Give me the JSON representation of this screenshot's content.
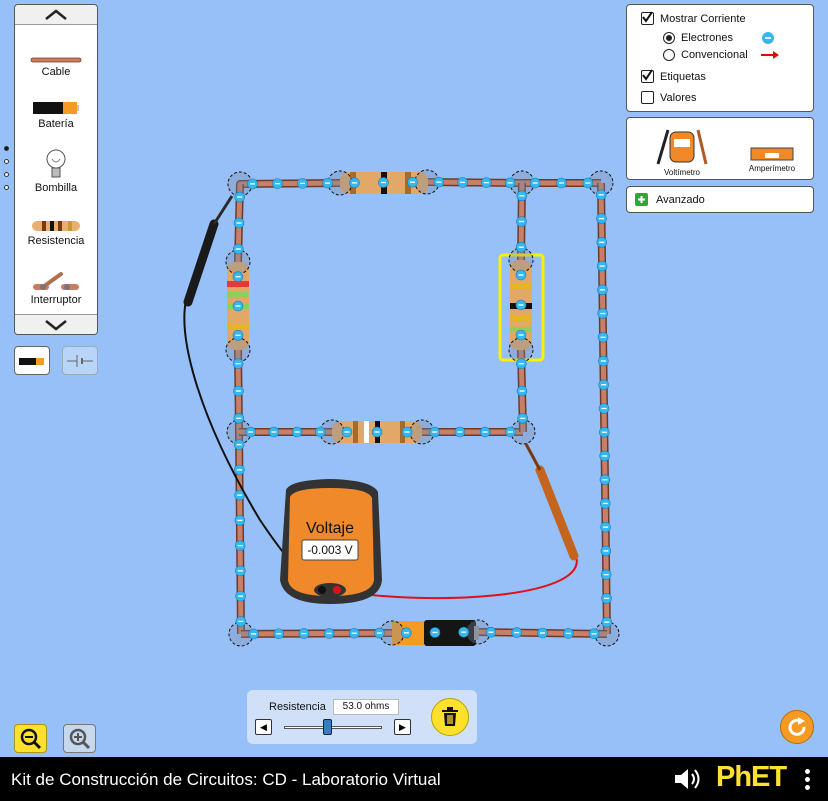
{
  "toolbox": {
    "items": [
      {
        "label": "Cable",
        "icon": "wire-icon"
      },
      {
        "label": "Batería",
        "icon": "battery-icon"
      },
      {
        "label": "Bombilla",
        "icon": "lightbulb-icon"
      },
      {
        "label": "Resistencia",
        "icon": "resistor-icon"
      },
      {
        "label": "Interruptor",
        "icon": "switch-icon"
      }
    ],
    "up_icon": "chevron-up-icon",
    "down_icon": "chevron-down-icon"
  },
  "controls": {
    "show_current": {
      "label": "Mostrar Corriente",
      "checked": true
    },
    "electrons": {
      "label": "Electrones",
      "selected": true
    },
    "conventional": {
      "label": "Convencional",
      "selected": false
    },
    "labels": {
      "label": "Etiquetas",
      "checked": true
    },
    "values": {
      "label": "Valores",
      "checked": false
    }
  },
  "meters": {
    "voltmeter_label": "Voltímetro",
    "ammeter_label": "Amperímetro"
  },
  "advanced": {
    "label": "Avanzado"
  },
  "voltmeter": {
    "title": "Voltaje",
    "reading": "-0.003 V"
  },
  "slider": {
    "label": "Resistencia",
    "value": "53.0 ohms"
  },
  "title_bar": {
    "title": "Kit de Construcción de Circuitos: CD - Laboratorio Virtual",
    "logo": "PhET"
  },
  "colors": {
    "background": "#98c0f8",
    "wire": "#b87a5e",
    "electron": "#37b7f0",
    "selection": "#fdf000",
    "accent": "#fde12c",
    "reset": "#f59a23"
  }
}
